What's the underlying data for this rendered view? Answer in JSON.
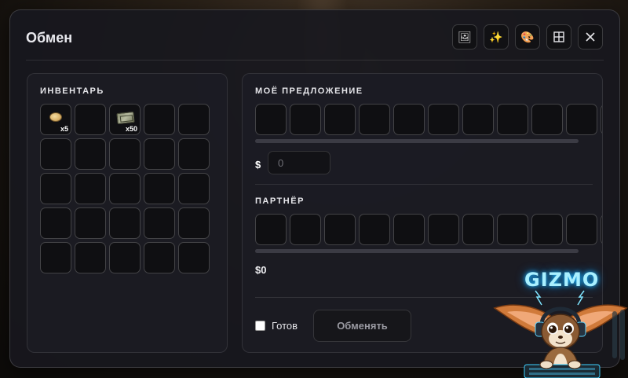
{
  "window": {
    "title": "Обмен"
  },
  "toolbar": {
    "buttons": [
      {
        "icon": "image-frame-icon",
        "glyph": "🖼"
      },
      {
        "icon": "sparkles-icon",
        "glyph": "✨"
      },
      {
        "icon": "palette-icon",
        "glyph": "🎨"
      },
      {
        "icon": "grid-icon",
        "glyph": ""
      },
      {
        "icon": "close-icon",
        "glyph": ""
      }
    ]
  },
  "inventory": {
    "title": "ИНВЕНТАРЬ",
    "slots": 25,
    "items": [
      {
        "slot": 0,
        "icon": "coin-icon",
        "qty": "x5"
      },
      {
        "slot": 2,
        "icon": "cash-stack-icon",
        "qty": "x50"
      }
    ]
  },
  "my_offer": {
    "title": "МОЁ ПРЕДЛОЖЕНИЕ",
    "currency_symbol": "$",
    "money_placeholder": "0"
  },
  "partner": {
    "title": "ПАРТНЁР",
    "money": "$0"
  },
  "footer": {
    "ready_label": "Готов",
    "exchange_label": "Обменять"
  },
  "overlay": {
    "logo_text": "GIZMO"
  },
  "colors": {
    "panel_bg": "#1c1c23",
    "slot_bg": "#0f0f12",
    "logo_glow": "#1fb8ff"
  }
}
